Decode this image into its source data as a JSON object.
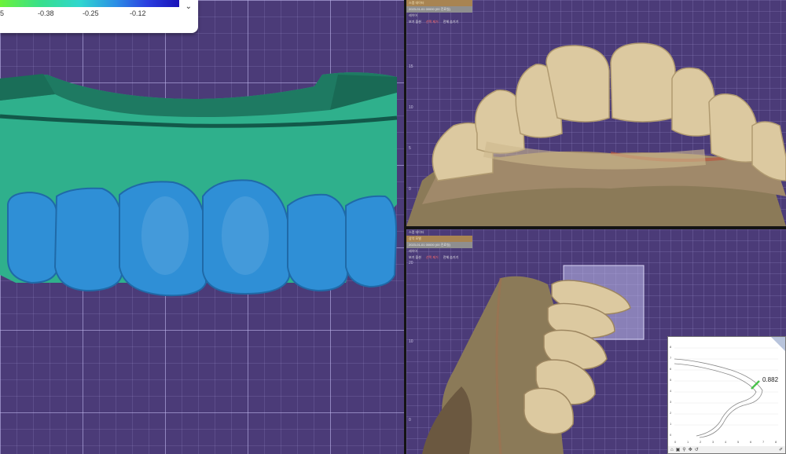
{
  "legend": {
    "labels": [
      "5",
      "-0.38",
      "-0.25",
      "-0.12"
    ],
    "chevron": "chevron-down-icon"
  },
  "top_panel": {
    "tree": {
      "row1": "스캠 데이터",
      "row2": "2023-01-01 00000 (00 진료실)",
      "row3": "레이어",
      "bottom_left": "보기 옵션",
      "bottom_mid": "선택 제거",
      "bottom_right": "전체 숨기기"
    },
    "axis": [
      "15",
      "10",
      "5",
      "0"
    ]
  },
  "bottom_panel": {
    "tree": {
      "row0": "스캠 데이터",
      "row1": "상악 모델",
      "row2": "2023-01-01 00000 (00 진료실)",
      "row3": "레이어",
      "bottom_left": "보기 옵션",
      "bottom_mid": "선택 제거",
      "bottom_right": "전체 숨기기"
    },
    "axis": [
      "20",
      "10",
      "0"
    ],
    "inset": {
      "measurement": "0.882",
      "y_ticks": [
        "8",
        "7",
        "6",
        "5",
        "4",
        "3",
        "2",
        "1",
        "0"
      ],
      "x_ticks": [
        "0",
        "1",
        "2",
        "3",
        "4",
        "5",
        "6",
        "7",
        "8"
      ]
    }
  },
  "colors": {
    "viewport_bg": "#4b3b78",
    "model_green": "#2fb08c",
    "tooth_blue": "#2f8fd6",
    "tooth_cream": "#d8c8a0"
  }
}
